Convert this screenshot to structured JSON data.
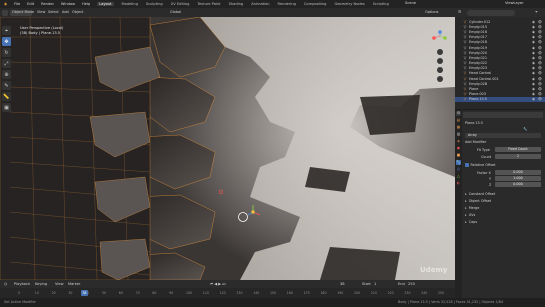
{
  "menu": [
    "File",
    "Edit",
    "Render",
    "Window",
    "Help"
  ],
  "workspace_tabs": [
    "Layout",
    "Modeling",
    "Sculpting",
    "UV Editing",
    "Texture Paint",
    "Shading",
    "Animation",
    "Rendering",
    "Compositing",
    "Geometry Nodes",
    "Scripting"
  ],
  "active_workspace": "Layout",
  "scene": "Scene",
  "view_layer": "ViewLayer",
  "viewport_header": {
    "mode": "Object Mode",
    "view": "View",
    "select": "Select",
    "add": "Add",
    "object": "Object",
    "orientation_label": "Orientation:",
    "orientation_value": "Default",
    "drag": "Drag:",
    "drag_value": "Select Box",
    "transform": "Global",
    "options": "Options"
  },
  "overlay": {
    "line1": "User Perspective (Local)",
    "line2": "(38) Body | Plane.13.5"
  },
  "outliner_items": [
    {
      "name": "Cylinder.012",
      "color": "#e8a050"
    },
    {
      "name": "Empty.015",
      "color": "#d0d0d0"
    },
    {
      "name": "Empty.016",
      "color": "#d0d0d0"
    },
    {
      "name": "Empty.017",
      "color": "#d0d0d0"
    },
    {
      "name": "Empty.018",
      "color": "#d0d0d0"
    },
    {
      "name": "Empty.019",
      "color": "#d0d0d0"
    },
    {
      "name": "Empty.020",
      "color": "#d0d0d0"
    },
    {
      "name": "Empty.021",
      "color": "#d0d0d0"
    },
    {
      "name": "Empty.022",
      "color": "#d0d0d0"
    },
    {
      "name": "Empty.023",
      "color": "#d0d0d0"
    },
    {
      "name": "Head Control",
      "color": "#e8a050"
    },
    {
      "name": "Head Control.001",
      "color": "#e8a050"
    },
    {
      "name": "Empty.02B",
      "color": "#d0d0d0"
    },
    {
      "name": "Plane",
      "color": "#e8a050"
    },
    {
      "name": "Plane.003",
      "color": "#e8a050"
    },
    {
      "name": "Plane.13.5",
      "color": "#e8a050"
    }
  ],
  "properties": {
    "object_name": "Plane.13.5",
    "modifier_name": "Array",
    "add_modifier": "Add Modifier",
    "fit_type_label": "Fit Type",
    "fit_type_value": "Fixed Count",
    "count_label": "Count",
    "count_value": "2",
    "relative_offset": "Relative Offset",
    "factor_x_label": "Factor X",
    "factor_x": "0.000",
    "y_label": "Y",
    "factor_y": "1.000",
    "z_label": "Z",
    "factor_z": "0.000",
    "sections": [
      "Constant Offset",
      "Object Offset",
      "Merge",
      "UVs",
      "Caps"
    ]
  },
  "timeline": {
    "playback": "Playback",
    "keying": "Keying",
    "view": "View",
    "marker": "Marker",
    "current_frame": "38",
    "start_label": "Start",
    "start": "1",
    "end_label": "End",
    "end": "250",
    "ticks": [
      "0",
      "10",
      "20",
      "30",
      "40",
      "50",
      "60",
      "70",
      "80",
      "90",
      "100",
      "110",
      "120",
      "130",
      "140",
      "150",
      "160",
      "170",
      "180",
      "190",
      "200",
      "210",
      "220",
      "230",
      "240",
      "250"
    ]
  },
  "statusbar": {
    "left": "Set Active Modifier",
    "right": "Body | Plane.13.5 | Verts 32,528 | Faces 31,232 | Objects 1/84"
  },
  "watermark": "Udemy",
  "colors": {
    "accent": "#4772b3",
    "selection_orange": "#f59b3a",
    "active_frame": "#4772b3"
  }
}
